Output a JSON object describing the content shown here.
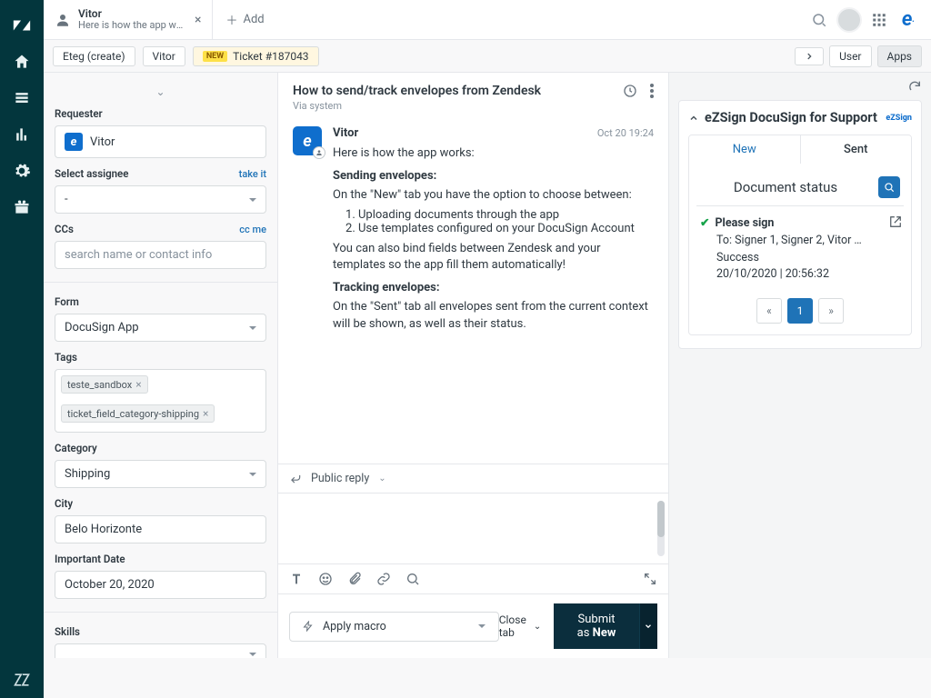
{
  "top": {
    "tab_title": "Vitor",
    "tab_subtitle": "Here is how the app wor...",
    "add_tab": "Add"
  },
  "breadcrumb": {
    "org": "Eteg (create)",
    "user": "Vitor",
    "new_badge": "NEW",
    "ticket": "Ticket #187043",
    "user_btn": "User",
    "apps_btn": "Apps"
  },
  "form": {
    "requester_label": "Requester",
    "requester_value": "Vitor",
    "assignee_label": "Select assignee",
    "assignee_take": "take it",
    "assignee_value": "-",
    "ccs_label": "CCs",
    "ccs_link": "cc me",
    "ccs_placeholder": "search name or contact info",
    "form_label": "Form",
    "form_value": "DocuSign App",
    "tags_label": "Tags",
    "tags": [
      "teste_sandbox",
      "ticket_field_category-shipping"
    ],
    "category_label": "Category",
    "category_value": "Shipping",
    "city_label": "City",
    "city_value": "Belo Horizonte",
    "date_label": "Important Date",
    "date_value": "October 20, 2020",
    "skills_label": "Skills"
  },
  "convo": {
    "title": "How to send/track envelopes from Zendesk",
    "via": "Via system",
    "author": "Vitor",
    "time": "Oct 20 19:24",
    "intro": "Here is how the app works:",
    "send_heading": "Sending envelopes:",
    "send_intro": "On the \"New\" tab you have the option to choose between:",
    "send_item1": "Uploading documents through the app",
    "send_item2": "Use templates configured on your DocuSign Account",
    "send_bind": "You can also bind fields between Zendesk and your templates so the app fill them automatically!",
    "track_heading": "Tracking envelopes:",
    "track_body": "On the \"Sent\" tab all envelopes sent from the current context will be shown, as well as their status.",
    "reply_label": "Public reply",
    "macro_label": "Apply macro"
  },
  "apps": {
    "card_title": "eZSign DocuSign for Support",
    "logo_text": "eZSign",
    "tab_new": "New",
    "tab_sent": "Sent",
    "status_title": "Document status",
    "env_title": "Please sign",
    "env_to": "To: Signer 1, Signer 2, Vitor …",
    "env_status": "Success",
    "env_time": "20/10/2020 | 20:56:32",
    "page_current": "1"
  },
  "footer": {
    "close_tab": "Close tab",
    "submit_prefix": "Submit as ",
    "submit_status": "New"
  }
}
